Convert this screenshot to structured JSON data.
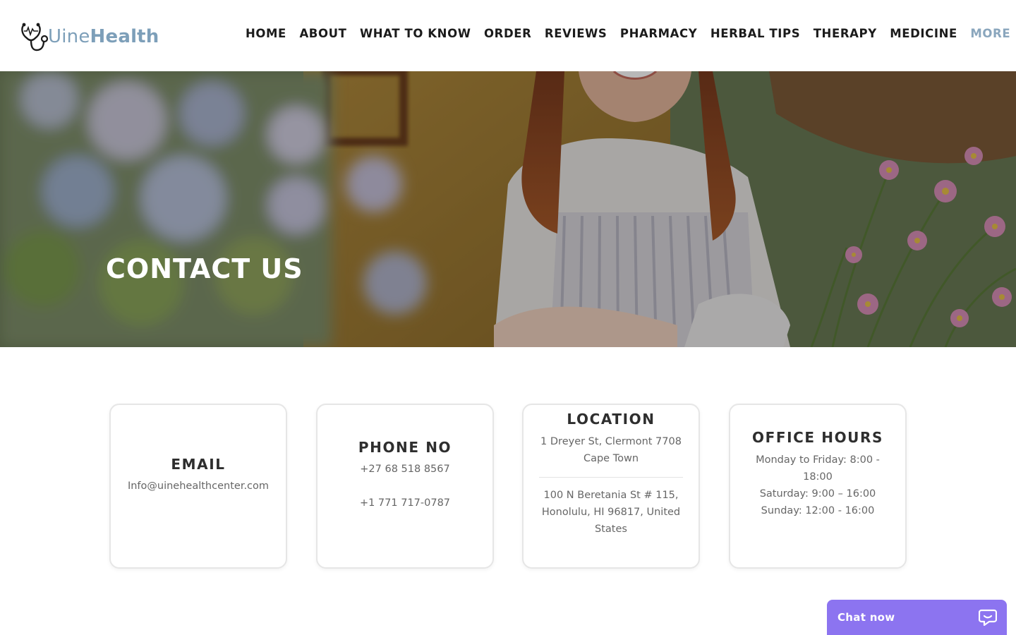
{
  "brand": {
    "name_light": "Uine",
    "name_bold": "Health",
    "color": "#7d9fb9"
  },
  "nav": {
    "items": [
      "HOME",
      "ABOUT",
      "WHAT TO KNOW",
      "ORDER",
      "REVIEWS",
      "PHARMACY",
      "HERBAL TIPS",
      "THERAPY",
      "MEDICINE"
    ],
    "more_label": "MORE",
    "more_color": "#8aa6bd"
  },
  "hero": {
    "title": "CONTACT US"
  },
  "cards": {
    "email": {
      "title": "EMAIL",
      "value": "Info@uinehealthcenter.com"
    },
    "phone": {
      "title": "PHONE NO",
      "line1": "+27 68 518 8567",
      "line2": "+1 771 717-0787"
    },
    "location": {
      "title": "LOCATION",
      "addr1_line1": "1 Dreyer St, Clermont 7708",
      "addr1_line2": "Cape Town",
      "addr2_line1": "100 N Beretania St # 115,",
      "addr2_line2": "Honolulu, HI 96817, United",
      "addr2_line3": "States"
    },
    "hours": {
      "title": "OFFICE HOURS",
      "line1": "Monday to Friday: 8:00 -",
      "line2": "18:00",
      "line3": "Saturday: 9:00 – 16:00",
      "line4": "Sunday: 12:00 - 16:00"
    }
  },
  "chat": {
    "label": "Chat now",
    "color": "#8c74f0",
    "icon": "chat-bubble-icon"
  }
}
